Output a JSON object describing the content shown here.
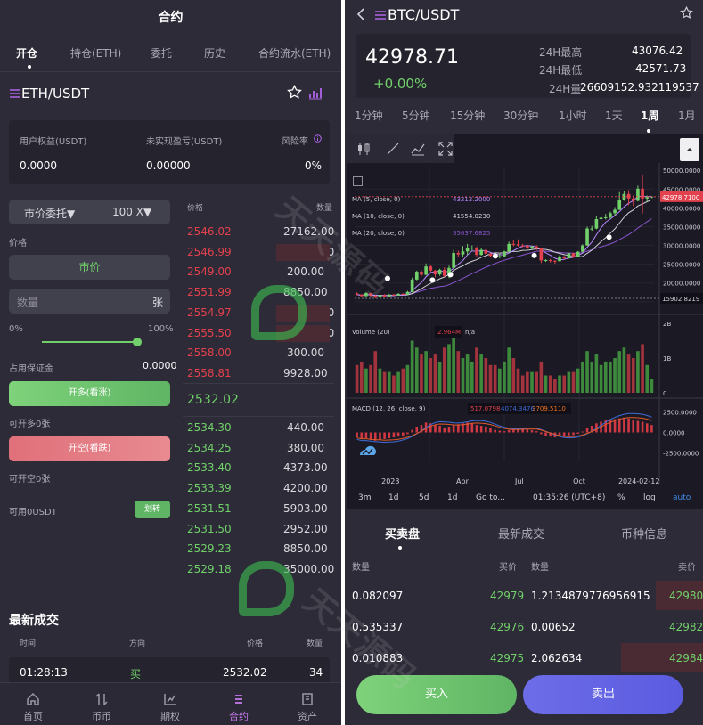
{
  "left": {
    "title": "合约",
    "tabs": [
      {
        "label": "开仓",
        "active": true
      },
      {
        "label": "持仓(ETH)"
      },
      {
        "label": "委托"
      },
      {
        "label": "历史"
      },
      {
        "label": "合约流水(ETH)"
      }
    ],
    "pair": "ETH/USDT",
    "account": {
      "equity_label": "用户权益(USDT)",
      "equity_value": "0.0000",
      "pnl_label": "未实现盈亏(USDT)",
      "pnl_value": "0.00000",
      "risk_label": "风险率",
      "risk_value": "0%"
    },
    "order_type": "市价委托▼",
    "leverage": "100 X▼",
    "price_label": "价格",
    "price_mode": "市价",
    "qty_placeholder": "数量",
    "qty_unit": "张",
    "slider": {
      "min_label": "0%",
      "max_label": "100%",
      "value_percent": 100
    },
    "margin_label": "占用保证金",
    "margin_value": "0.0000",
    "long_button": "开多(看涨)",
    "long_available": "可开多0张",
    "short_button": "开空(看跌)",
    "short_available": "可开空0张",
    "available": "可用0USDT",
    "transfer_button": "划转",
    "book_headers": {
      "price": "价格",
      "qty": "数量"
    },
    "asks": [
      {
        "price": "2546.02",
        "qty": "27162.00"
      },
      {
        "price": "2546.99",
        "qty": "70000.00"
      },
      {
        "price": "2549.00",
        "qty": "200.00"
      },
      {
        "price": "2551.99",
        "qty": "8850.00"
      },
      {
        "price": "2554.97",
        "qty": "70000.00"
      },
      {
        "price": "2555.50",
        "qty": "51604.00"
      },
      {
        "price": "2558.00",
        "qty": "300.00"
      },
      {
        "price": "2558.81",
        "qty": "9928.00"
      }
    ],
    "last_price": "2532.02",
    "bids": [
      {
        "price": "2534.30",
        "qty": "440.00"
      },
      {
        "price": "2534.25",
        "qty": "380.00"
      },
      {
        "price": "2533.40",
        "qty": "4373.00"
      },
      {
        "price": "2533.39",
        "qty": "4200.00"
      },
      {
        "price": "2531.51",
        "qty": "5903.00"
      },
      {
        "price": "2531.50",
        "qty": "2952.00"
      },
      {
        "price": "2529.23",
        "qty": "8850.00"
      },
      {
        "price": "2529.18",
        "qty": "35000.00"
      }
    ],
    "recent": {
      "title": "最新成交",
      "headers": {
        "time": "时间",
        "side": "方向",
        "price": "价格",
        "qty": "数量"
      },
      "rows": [
        {
          "time": "01:28:13",
          "side": "买",
          "price": "2532.02",
          "qty": "34"
        }
      ]
    },
    "nav": [
      {
        "label": "首页",
        "icon": "home-icon"
      },
      {
        "label": "币币",
        "icon": "coin-icon"
      },
      {
        "label": "期权",
        "icon": "options-icon"
      },
      {
        "label": "合约",
        "icon": "contract-icon",
        "active": true
      },
      {
        "label": "资产",
        "icon": "assets-icon"
      }
    ],
    "watermark": "天天源码"
  },
  "right": {
    "pair": "BTC/USDT",
    "price": "42978.71",
    "change": "+0.00%",
    "stats": {
      "high_label": "24H最高",
      "high": "43076.42",
      "low_label": "24H最低",
      "low": "42571.73",
      "vol_label": "24H量",
      "vol": "26609152.932119537"
    },
    "intervals": [
      "1分钟",
      "5分钟",
      "15分钟",
      "30分钟",
      "1小时",
      "1天",
      "1周",
      "1月"
    ],
    "active_interval": "1周",
    "chart_data": {
      "type": "candlestick",
      "series_ma": [
        {
          "name": "MA (5, close, 0)",
          "value": "43212.2000",
          "color": "#b887ff"
        },
        {
          "name": "MA (10, close, 0)",
          "value": "41554.0230",
          "color": "#cfcfd6"
        },
        {
          "name": "MA (20, close, 0)",
          "value": "35637.6825",
          "color": "#8a55d0"
        }
      ],
      "price_axis": [
        "50000.0000",
        "45000.0000",
        "40000.0000",
        "35000.0000",
        "30000.0000",
        "25000.0000",
        "20000.0000",
        "15000.0000"
      ],
      "current_price_tag": "42978.7100",
      "low_tag": "15902.8219",
      "ylim": [
        14000,
        51000
      ],
      "candles": [
        [
          17200,
          16900,
          17500,
          16700
        ],
        [
          16900,
          16500,
          17000,
          16300
        ],
        [
          16500,
          17300,
          17600,
          16400
        ],
        [
          17300,
          16600,
          17400,
          16400
        ],
        [
          16600,
          16200,
          16800,
          15900
        ],
        [
          16200,
          16800,
          17000,
          16000
        ],
        [
          16800,
          16400,
          17000,
          16200
        ],
        [
          16400,
          16900,
          17100,
          16300
        ],
        [
          16900,
          16700,
          17100,
          16600
        ],
        [
          16700,
          17100,
          17300,
          16600
        ],
        [
          17100,
          16900,
          17300,
          16800
        ],
        [
          16900,
          17600,
          17900,
          16800
        ],
        [
          17600,
          20900,
          21400,
          17500
        ],
        [
          20900,
          23000,
          23300,
          20700
        ],
        [
          23000,
          22200,
          23400,
          21800
        ],
        [
          22200,
          24400,
          25200,
          22000
        ],
        [
          24400,
          23300,
          24700,
          22900
        ],
        [
          23300,
          22300,
          23500,
          21500
        ],
        [
          22300,
          23500,
          23800,
          21900
        ],
        [
          23500,
          21900,
          24200,
          21600
        ],
        [
          21900,
          24000,
          24600,
          21300
        ],
        [
          24000,
          28000,
          28800,
          23800
        ],
        [
          28000,
          27600,
          28600,
          26800
        ],
        [
          27600,
          28400,
          29800,
          27000
        ],
        [
          28400,
          29200,
          30400,
          27500
        ],
        [
          29200,
          29400,
          30000,
          28600
        ],
        [
          29400,
          27500,
          29700,
          26900
        ],
        [
          27500,
          28800,
          29200,
          27300
        ],
        [
          28800,
          27800,
          29000,
          26500
        ],
        [
          27800,
          27200,
          28000,
          26800
        ],
        [
          27200,
          26800,
          27400,
          26300
        ],
        [
          26800,
          27100,
          27800,
          26600
        ],
        [
          27100,
          28400,
          28600,
          26900
        ],
        [
          28400,
          30400,
          31000,
          28200
        ],
        [
          30400,
          30300,
          31300,
          29800
        ],
        [
          30300,
          30000,
          31600,
          29700
        ],
        [
          30000,
          29900,
          30400,
          29500
        ],
        [
          29900,
          29200,
          30200,
          29000
        ],
        [
          29200,
          29700,
          29900,
          28900
        ],
        [
          29700,
          29200,
          30100,
          28700
        ],
        [
          29200,
          26000,
          29400,
          25300
        ],
        [
          26000,
          26100,
          26300,
          25600
        ],
        [
          26100,
          25900,
          26400,
          25400
        ],
        [
          25900,
          25800,
          26100,
          25100
        ],
        [
          25800,
          27000,
          27400,
          25700
        ],
        [
          27000,
          26600,
          27200,
          26300
        ],
        [
          26600,
          27900,
          28000,
          26500
        ],
        [
          27900,
          26900,
          28100,
          26700
        ],
        [
          26900,
          28300,
          28500,
          26800
        ],
        [
          28300,
          30000,
          30300,
          28100
        ],
        [
          30000,
          34500,
          35000,
          29900
        ],
        [
          34500,
          34500,
          35200,
          33900
        ],
        [
          34500,
          37000,
          37900,
          34300
        ],
        [
          37000,
          37400,
          37800,
          35600
        ],
        [
          37400,
          37500,
          38400,
          36900
        ],
        [
          37500,
          38600,
          39000,
          37100
        ],
        [
          38600,
          39500,
          40200,
          37800
        ],
        [
          39500,
          42000,
          44200,
          39400
        ],
        [
          42000,
          43700,
          44500,
          41900
        ],
        [
          43700,
          42500,
          44700,
          40700
        ],
        [
          42500,
          41900,
          43300,
          40500
        ],
        [
          41900,
          45100,
          45900,
          41700
        ],
        [
          45100,
          42500,
          48900,
          38500
        ],
        [
          42500,
          42900,
          43300,
          41700
        ],
        [
          42900,
          43000,
          43100,
          42600
        ]
      ],
      "volume_axis": [
        "2B",
        "1B",
        "0"
      ],
      "volume_label": "Volume (20)",
      "volume_value": "2.964M",
      "volume_na": "n/a",
      "volume_ylim": [
        0,
        2
      ],
      "volumes": [
        0.8,
        0.9,
        0.7,
        0.8,
        1.2,
        0.7,
        0.6,
        0.6,
        0.5,
        0.6,
        0.7,
        0.8,
        1.5,
        1.3,
        1.1,
        1.2,
        1.0,
        1.1,
        0.9,
        1.3,
        1.4,
        1.6,
        1.2,
        1.0,
        1.1,
        0.9,
        1.3,
        1.1,
        1.0,
        0.8,
        0.8,
        0.7,
        0.9,
        1.3,
        1.0,
        0.7,
        0.5,
        0.6,
        0.6,
        0.6,
        0.9,
        0.5,
        0.5,
        0.4,
        0.5,
        0.5,
        0.6,
        0.6,
        0.7,
        0.9,
        1.2,
        0.9,
        1.1,
        0.8,
        0.9,
        0.9,
        1.0,
        1.2,
        1.3,
        1.1,
        1.0,
        1.2,
        1.4,
        0.8,
        0.4
      ],
      "macd_label": "MACD (12, 26, close, 9)",
      "macd_values": [
        "517.0798",
        "4074.3476",
        "3709.5110"
      ],
      "macd_axis": [
        "2500.0000",
        "0.0000",
        "-2500.0000"
      ],
      "macd_ylim": [
        -3500,
        3500
      ],
      "macd_hist": [
        -600,
        -800,
        -700,
        -900,
        -1000,
        -900,
        -800,
        -700,
        -600,
        -500,
        -400,
        -200,
        300,
        700,
        900,
        1200,
        1100,
        900,
        800,
        600,
        700,
        900,
        1000,
        1100,
        1200,
        1100,
        900,
        800,
        700,
        500,
        300,
        200,
        150,
        300,
        450,
        500,
        450,
        350,
        250,
        150,
        -200,
        -400,
        -500,
        -600,
        -500,
        -450,
        -350,
        -300,
        -150,
        100,
        500,
        800,
        1100,
        1300,
        1450,
        1550,
        1600,
        1700,
        1800,
        1700,
        1500,
        1400,
        1300,
        1100,
        900
      ],
      "x_labels": [
        "2023",
        "Apr",
        "Jul",
        "Oct",
        "2024-02-12"
      ]
    },
    "chart_toolbar": [
      "3m",
      "1d",
      "5d",
      "1d",
      "Go to...",
      "01:35:26 (UTC+8)",
      "%",
      "log",
      "auto"
    ],
    "book_tabs": [
      {
        "label": "买卖盘",
        "active": true
      },
      {
        "label": "最新成交"
      },
      {
        "label": "币种信息"
      }
    ],
    "book_headers": {
      "qty": "数量",
      "bid": "买价",
      "qty2": "数量",
      "ask": "卖价"
    },
    "book_rows": [
      {
        "bid_qty": "0.082097",
        "bid": "42979",
        "ask_qty": "1.2134879776956915",
        "ask": "42980"
      },
      {
        "bid_qty": "0.535337",
        "bid": "42976",
        "ask_qty": "0.00652",
        "ask": "42982"
      },
      {
        "bid_qty": "0.010883",
        "bid": "42975",
        "ask_qty": "2.062634",
        "ask": "42984"
      }
    ],
    "buy_button": "买入",
    "sell_button": "卖出"
  }
}
